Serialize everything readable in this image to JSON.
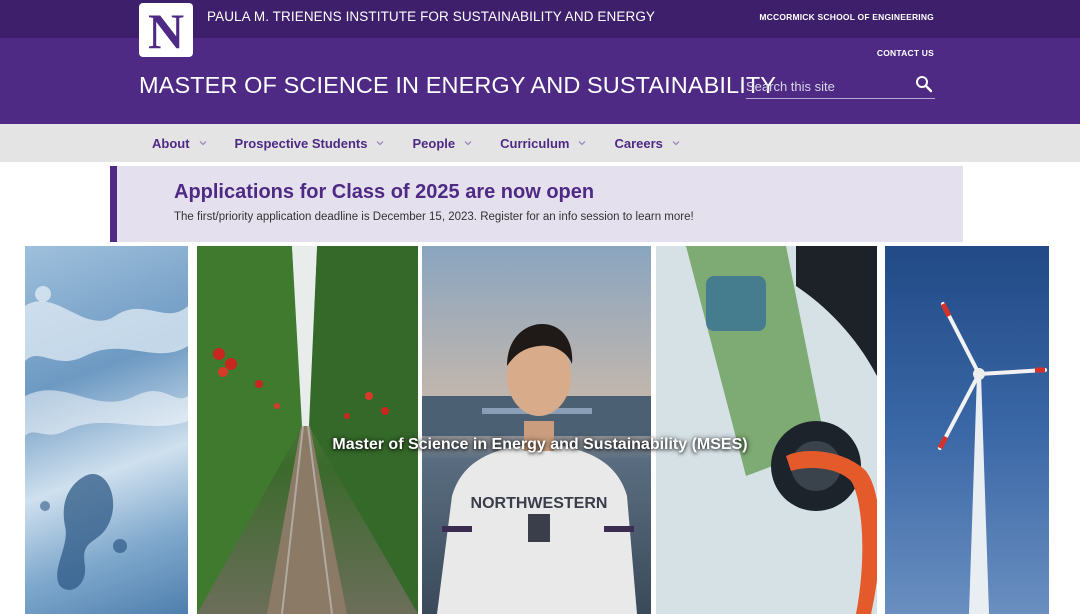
{
  "topbar": {
    "institute": "PAULA M. TRIENENS INSTITUTE FOR SUSTAINABILITY AND ENERGY",
    "school_link": "MCCORMICK SCHOOL OF ENGINEERING"
  },
  "logo": {
    "letter": "N"
  },
  "header": {
    "contact": "CONTACT US",
    "title": "MASTER OF SCIENCE IN ENERGY AND SUSTAINABILITY",
    "search_placeholder": "Search this site",
    "search_icon": "search-icon"
  },
  "nav": {
    "items": [
      {
        "label": "About"
      },
      {
        "label": "Prospective Students"
      },
      {
        "label": "People"
      },
      {
        "label": "Curriculum"
      },
      {
        "label": "Careers"
      }
    ]
  },
  "alert": {
    "title": "Applications for Class of 2025 are now open",
    "text": "The first/priority application deadline is December 15, 2023.  Register for an info session to learn more!"
  },
  "hero": {
    "title": "Master of Science in Energy and Sustainability (MSES)",
    "panels": [
      "water-image",
      "greenhouse-image",
      "student-image",
      "ev-charging-image",
      "wind-turbine-image"
    ],
    "student_shirt": "NORTHWESTERN"
  },
  "colors": {
    "purple_dark": "#3e1f6b",
    "purple": "#4e2a84",
    "nav_bg": "#e4e4e4",
    "alert_bg": "#e4e0ee"
  }
}
